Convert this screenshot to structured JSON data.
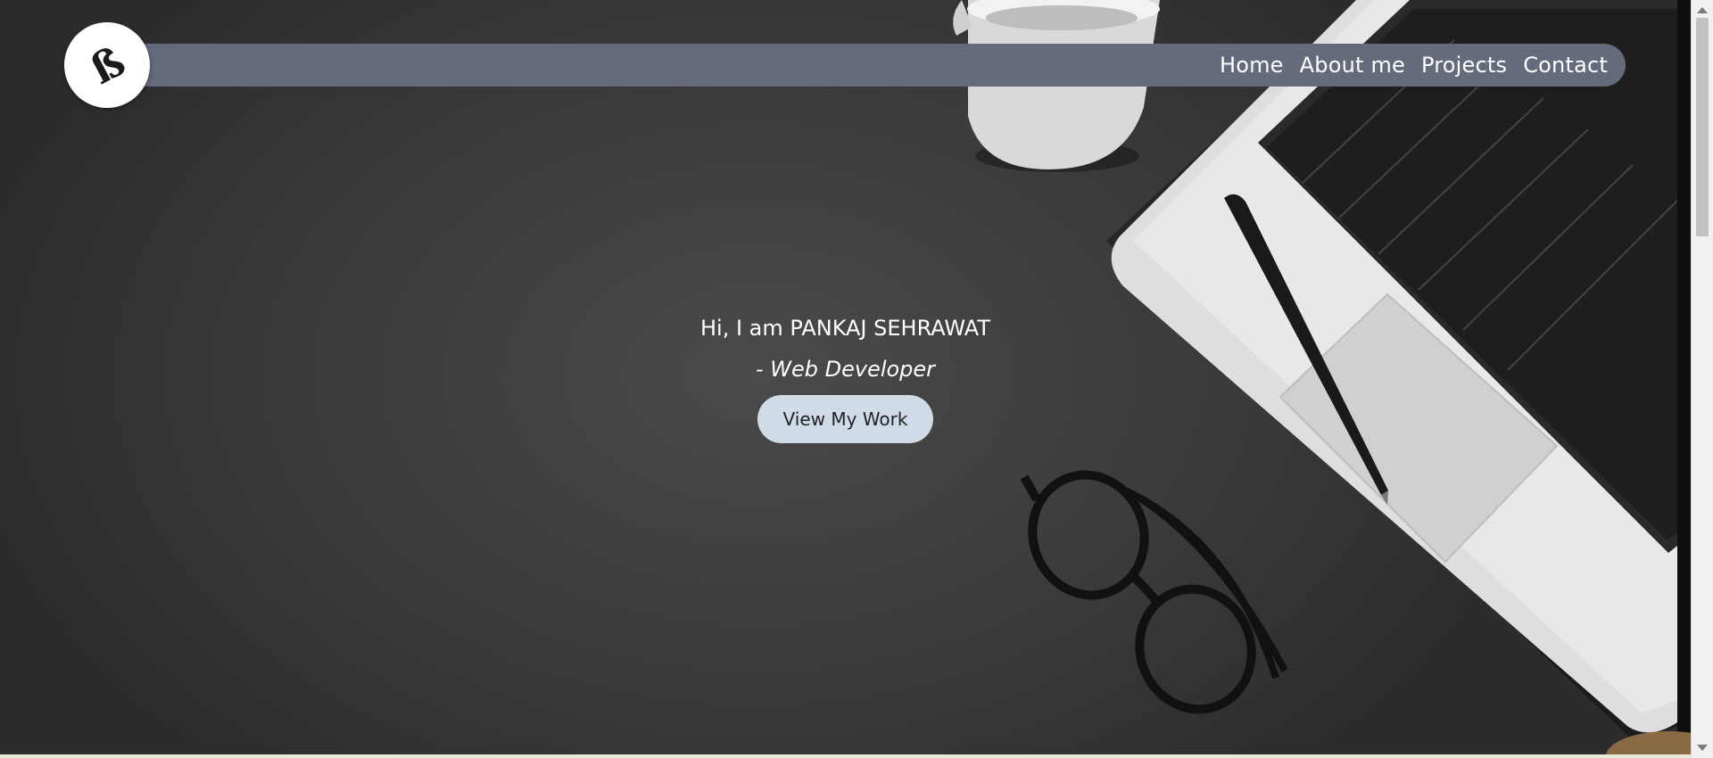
{
  "logo": {
    "glyph": "ß"
  },
  "nav": {
    "items": [
      {
        "label": "Home"
      },
      {
        "label": "About me"
      },
      {
        "label": "Projects"
      },
      {
        "label": "Contact"
      }
    ]
  },
  "hero": {
    "greeting": "Hi, I am PANKAJ SEHRAWAT",
    "role": "- Web Developer",
    "cta_label": "View My Work"
  },
  "colors": {
    "navbar": "#646b7b",
    "cta": "#cfdbe7",
    "background": "#3a3a3b"
  },
  "icons": [
    "logo-icon",
    "scroll-up-icon",
    "scroll-down-icon"
  ]
}
